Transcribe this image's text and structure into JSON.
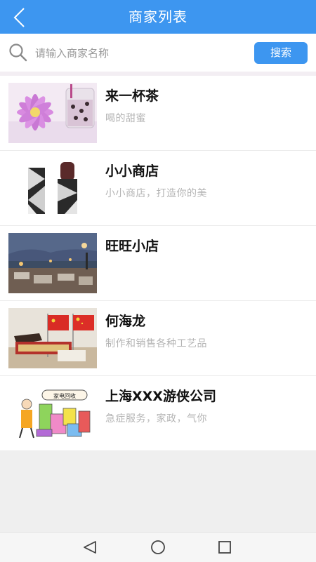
{
  "header": {
    "title": "商家列表",
    "back_icon": "chevron-left-icon"
  },
  "search": {
    "placeholder": "请输入商家名称",
    "button_label": "搜索",
    "icon": "search-icon"
  },
  "merchants": [
    {
      "name": "来一杯茶",
      "description": "喝的甜蜜",
      "thumbnail": "flower-milk-tea-image"
    },
    {
      "name": "小小商店",
      "description": "小小商店，打造你的美",
      "thumbnail": "lipstick-image"
    },
    {
      "name": "旺旺小店",
      "description": "",
      "thumbnail": "night-street-image"
    },
    {
      "name": "何海龙",
      "description": "制作和销售各种工艺品",
      "thumbnail": "flags-handicraft-image"
    },
    {
      "name": "上海XXX游侠公司",
      "description": "急症服务，家政，气你",
      "thumbnail": "appliance-recycling-image",
      "thumbnail_text": "家电回收"
    }
  ],
  "system_nav": {
    "back": "triangle-back-icon",
    "home": "circle-home-icon",
    "recents": "square-recents-icon"
  },
  "colors": {
    "accent": "#3d96f0",
    "background": "#efefef"
  }
}
